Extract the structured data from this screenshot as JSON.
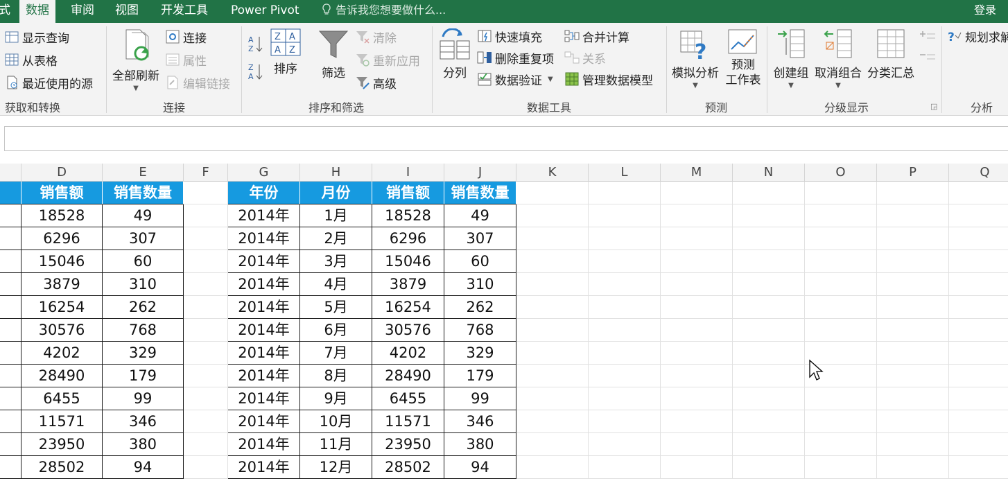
{
  "menu": {
    "tabs": [
      "式",
      "数据",
      "审阅",
      "视图",
      "开发工具",
      "Power Pivot"
    ],
    "active_tab": "数据",
    "tell_me": "告诉我您想要做什么...",
    "login": "登录"
  },
  "ribbon": {
    "get_transform": {
      "label": "获取和转换",
      "show_query": "显示查询",
      "from_table": "从表格",
      "recent_sources": "最近使用的源"
    },
    "connections": {
      "label": "连接",
      "refresh_all": "全部刷新",
      "connections": "连接",
      "properties": "属性",
      "edit_links": "编辑链接"
    },
    "sort_filter": {
      "label": "排序和筛选",
      "sort": "排序",
      "filter": "筛选",
      "clear": "清除",
      "reapply": "重新应用",
      "advanced": "高级"
    },
    "data_tools": {
      "label": "数据工具",
      "text_to_columns": "分列",
      "flash_fill": "快速填充",
      "remove_duplicates": "删除重复项",
      "data_validation": "数据验证",
      "consolidate": "合并计算",
      "relationships": "关系",
      "manage_data_model": "管理数据模型"
    },
    "forecast": {
      "label": "预测",
      "what_if": "模拟分析",
      "forecast_sheet_line1": "预测",
      "forecast_sheet_line2": "工作表"
    },
    "outline": {
      "label": "分级显示",
      "group": "创建组",
      "ungroup": "取消组合",
      "subtotal": "分类汇总"
    },
    "analysis": {
      "label": "分析",
      "solver": "规划求解"
    }
  },
  "columns": [
    "D",
    "E",
    "F",
    "G",
    "H",
    "I",
    "J",
    "K",
    "L",
    "M",
    "N",
    "O",
    "P",
    "Q"
  ],
  "left_table": {
    "headers": [
      "销售额",
      "销售数量"
    ],
    "rows": [
      [
        "18528",
        "49"
      ],
      [
        "6296",
        "307"
      ],
      [
        "15046",
        "60"
      ],
      [
        "3879",
        "310"
      ],
      [
        "16254",
        "262"
      ],
      [
        "30576",
        "768"
      ],
      [
        "4202",
        "329"
      ],
      [
        "28490",
        "179"
      ],
      [
        "6455",
        "99"
      ],
      [
        "11571",
        "346"
      ],
      [
        "23950",
        "380"
      ],
      [
        "28502",
        "94"
      ]
    ]
  },
  "right_table": {
    "headers": [
      "年份",
      "月份",
      "销售额",
      "销售数量"
    ],
    "rows": [
      [
        "2014年",
        "1月",
        "18528",
        "49"
      ],
      [
        "2014年",
        "2月",
        "6296",
        "307"
      ],
      [
        "2014年",
        "3月",
        "15046",
        "60"
      ],
      [
        "2014年",
        "4月",
        "3879",
        "310"
      ],
      [
        "2014年",
        "5月",
        "16254",
        "262"
      ],
      [
        "2014年",
        "6月",
        "30576",
        "768"
      ],
      [
        "2014年",
        "7月",
        "4202",
        "329"
      ],
      [
        "2014年",
        "8月",
        "28490",
        "179"
      ],
      [
        "2014年",
        "9月",
        "6455",
        "99"
      ],
      [
        "2014年",
        "10月",
        "11571",
        "346"
      ],
      [
        "2014年",
        "11月",
        "23950",
        "380"
      ],
      [
        "2014年",
        "12月",
        "28502",
        "94"
      ]
    ]
  },
  "colors": {
    "accent_green": "#217346",
    "header_blue": "#169ae0"
  }
}
